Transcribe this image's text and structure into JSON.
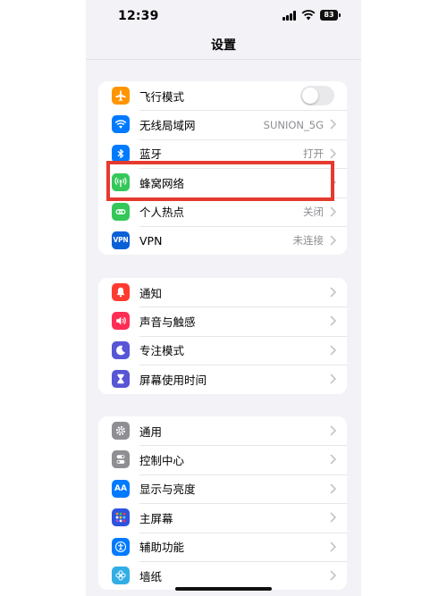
{
  "status_bar": {
    "time": "12:39",
    "battery": "83"
  },
  "nav": {
    "title": "设置"
  },
  "groups": [
    {
      "items": [
        {
          "id": "airplane",
          "label": "飞行模式",
          "value": "",
          "icon": "airplane-icon",
          "color": "#ff9500",
          "control": "toggle",
          "toggle_on": false
        },
        {
          "id": "wifi",
          "label": "无线局域网",
          "value": "SUNION_5G",
          "icon": "wifi-icon",
          "color": "#007aff",
          "control": "chevron"
        },
        {
          "id": "bluetooth",
          "label": "蓝牙",
          "value": "打开",
          "icon": "bluetooth-icon",
          "color": "#007aff",
          "control": "chevron"
        },
        {
          "id": "cellular",
          "label": "蜂窝网络",
          "value": "",
          "icon": "cellular-antenna-icon",
          "color": "#34c759",
          "control": "chevron"
        },
        {
          "id": "hotspot",
          "label": "个人热点",
          "value": "关闭",
          "icon": "hotspot-icon",
          "color": "#34c759",
          "control": "chevron"
        },
        {
          "id": "vpn",
          "label": "VPN",
          "value": "未连接",
          "icon": "vpn-icon",
          "color": "#0a60d6",
          "control": "chevron",
          "icon_text": "VPN"
        }
      ]
    },
    {
      "items": [
        {
          "id": "notifications",
          "label": "通知",
          "value": "",
          "icon": "bell-icon",
          "color": "#ff3b30",
          "control": "chevron"
        },
        {
          "id": "sounds",
          "label": "声音与触感",
          "value": "",
          "icon": "speaker-icon",
          "color": "#ff2d55",
          "control": "chevron"
        },
        {
          "id": "focus",
          "label": "专注模式",
          "value": "",
          "icon": "moon-icon",
          "color": "#5856d6",
          "control": "chevron"
        },
        {
          "id": "screentime",
          "label": "屏幕使用时间",
          "value": "",
          "icon": "hourglass-icon",
          "color": "#5856d6",
          "control": "chevron"
        }
      ]
    },
    {
      "items": [
        {
          "id": "general",
          "label": "通用",
          "value": "",
          "icon": "gear-icon",
          "color": "#8e8e93",
          "control": "chevron"
        },
        {
          "id": "control_center",
          "label": "控制中心",
          "value": "",
          "icon": "switches-icon",
          "color": "#8e8e93",
          "control": "chevron"
        },
        {
          "id": "display",
          "label": "显示与亮度",
          "value": "",
          "icon": "text-size-icon",
          "color": "#007aff",
          "control": "chevron",
          "icon_text": "AA"
        },
        {
          "id": "home_screen",
          "label": "主屏幕",
          "value": "",
          "icon": "app-grid-icon",
          "color": "#2c54e0",
          "control": "chevron"
        },
        {
          "id": "accessibility",
          "label": "辅助功能",
          "value": "",
          "icon": "accessibility-icon",
          "color": "#007aff",
          "control": "chevron"
        },
        {
          "id": "wallpaper",
          "label": "墙纸",
          "value": "",
          "icon": "flower-icon",
          "color": "#32ade6",
          "control": "chevron"
        }
      ]
    }
  ],
  "annotation": {
    "highlighted_item": "cellular",
    "color": "#e53a2f"
  }
}
